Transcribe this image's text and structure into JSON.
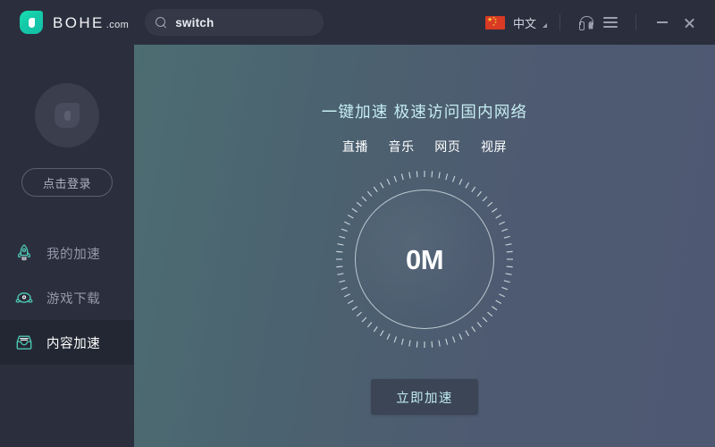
{
  "titlebar": {
    "logo_name": "BOHE",
    "logo_suffix": ".com",
    "logo_icon": "bohe-shield-logo",
    "search": {
      "value": "switch",
      "placeholder": "switch",
      "icon": "search-icon"
    },
    "language": {
      "label": "中文",
      "flag": "china-flag-icon",
      "caret": "chevron-down-icon"
    },
    "headset_icon": "headset-icon",
    "menu_icon": "hamburger-menu-icon",
    "minimize_icon": "minimize-icon",
    "close_icon": "close-icon"
  },
  "sidebar": {
    "avatar_icon": "default-avatar-icon",
    "login_label": "点击登录",
    "items": [
      {
        "label": "我的加速",
        "icon": "rocket-icon",
        "active": false
      },
      {
        "label": "游戏下载",
        "icon": "game-controller-icon",
        "active": false
      },
      {
        "label": "内容加速",
        "icon": "inbox-box-icon",
        "active": true
      }
    ]
  },
  "main": {
    "headline": "一键加速 极速访问国内网络",
    "subnav": [
      "直播",
      "音乐",
      "网页",
      "视屏"
    ],
    "dial": {
      "value": "0M",
      "ticks": 72
    },
    "cta_label": "立即加速"
  },
  "colors": {
    "brand_teal": "#14c9a8",
    "window_bg": "#2b2f3d",
    "sidebar_active": "#232733",
    "main_gradient_start": "#4c6d72",
    "main_gradient_end": "#4f5873",
    "headline_cyan": "#c6eef2",
    "cta_bg": "#3b4555",
    "cta_text": "#bfe9ee"
  }
}
